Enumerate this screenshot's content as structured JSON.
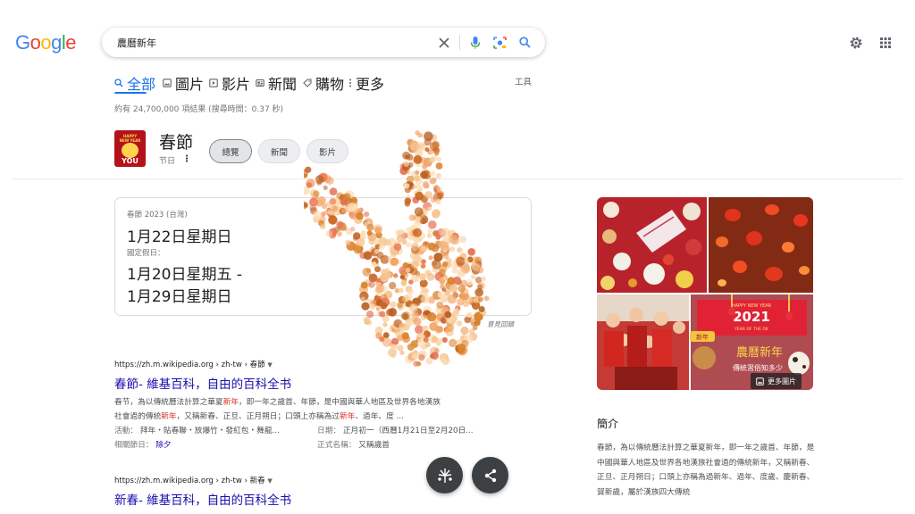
{
  "logo": {
    "text": "Google"
  },
  "search": {
    "query": "農曆新年"
  },
  "tabs": [
    {
      "label": "全部",
      "icon": "search-icon"
    },
    {
      "label": "圖片",
      "icon": "image-icon"
    },
    {
      "label": "影片",
      "icon": "video-icon"
    },
    {
      "label": "新聞",
      "icon": "news-icon"
    },
    {
      "label": "購物",
      "icon": "tag-icon"
    },
    {
      "label": "更多",
      "icon": "more-vert-icon"
    }
  ],
  "tools_label": "工具",
  "result_stats": "約有 24,700,000 項結果 (搜尋時間：0.37 秒)",
  "knowledge": {
    "thumb": {
      "line1": "HAPPY",
      "line2": "NEW YEAR",
      "line3": "YOU"
    },
    "title": "春節",
    "subtitle": "节日",
    "chips": [
      "總覽",
      "新聞",
      "影片"
    ]
  },
  "date_card": {
    "label1": "春節 2023 (台灣)",
    "date1": "1月22日星期日",
    "label2": "國定假日：",
    "date2_line1": "1月20日星期五 -",
    "date2_line2": "1月29日星期日",
    "feedback": "意見回饋"
  },
  "results": [
    {
      "url": "https://zh.m.wikipedia.org › zh-tw › 春節",
      "title": "春節- 維基百科，自由的百科全书",
      "snippet1_a": "春节，為以傳統曆法計算之華夏",
      "snippet1_hl": "新年",
      "snippet1_b": "，即一年之歲首、年節，是中國與華人地區及世界各地漢族",
      "snippet2_a": "社會過的傳統",
      "snippet2_hl1": "新年",
      "snippet2_b": "，又稱新春、正旦、正月朔日；口頭上亦稱為过",
      "snippet2_hl2": "新年",
      "snippet2_c": "、過年、度 ...",
      "attr1_label": "活動：",
      "attr1_value": "拜年・貼春聯・放爆竹・發紅包・舞龍...",
      "attr2_label": "日期：",
      "attr2_value": "正月初一（西曆1月21日至2月20日...",
      "attr3_label": "相關節日：",
      "attr3_value": "除夕",
      "attr4_label": "正式名稱：",
      "attr4_value": "又稱歲首"
    },
    {
      "url": "https://zh.m.wikipedia.org › zh-tw › 新春",
      "title": "新春- 維基百科，自由的百科全书"
    }
  ],
  "images": {
    "more_label": "更多圖片",
    "poster_line1": "HAPPY NEW YEAR",
    "poster_year": "2021",
    "poster_line2": "YEAR OF THE OX",
    "poster_title": "農曆新年",
    "poster_sub": "傳統習俗知多少",
    "poster_badge": "新年"
  },
  "intro": {
    "title": "簡介",
    "text": "春節，為以傳統曆法計算之華夏新年，即一年之歲首、年節，是中國與華人地區及世界各地漢族社會過的傳統新年，又稱新春、正旦、正月朔日；口頭上亦稱為過新年、過年、度歲、慶新春、賀新歲，屬於漢族四大傳統"
  },
  "colors": {
    "accent": "#1a73e8",
    "link": "#1a0dab",
    "highlight": "#d93025"
  }
}
